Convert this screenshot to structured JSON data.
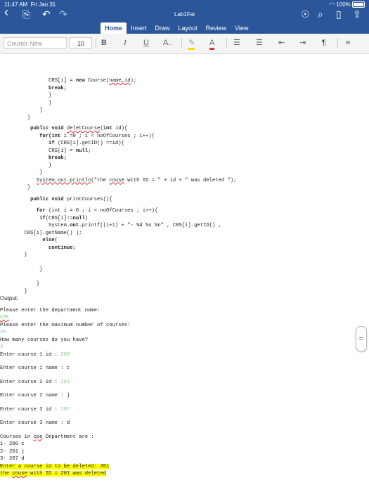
{
  "status": {
    "time": "11:47 AM",
    "date": "Fri Jan 31",
    "battery": "100%"
  },
  "title": "Lab1Fai",
  "tabs": [
    "Home",
    "Insert",
    "Draw",
    "Layout",
    "Review",
    "View"
  ],
  "ribbon": {
    "font_placeholder": "Courier New",
    "font_size": "10"
  },
  "icons": {
    "back": "chevron-left-icon",
    "file": "file-icon",
    "undo": "undo-icon",
    "redo": "redo-icon",
    "lightbulb": "lightbulb-icon",
    "search": "search-icon",
    "mobile": "mobile-view-icon",
    "share": "share-icon"
  },
  "colors": {
    "brand": "#2b579a",
    "highlight": "#ffff00",
    "input_value": "#8fc98f",
    "spell": "#d33333"
  },
  "code": {
    "l1_a": "CRS[i] = ",
    "l1_kw": "new",
    "l1_b": " Course(",
    "l1_sp": "name,id",
    "l1_c": ");",
    "l2": "break;",
    "l3": "}",
    "l4": "}",
    "l5": "}",
    "l6": "}",
    "l7_kw1": "public void",
    "l7_sp": "deletCourse",
    "l7_b": "(",
    "l7_kw2": "int",
    "l7_c": " id){",
    "l8_kw": "for(int",
    "l8_b": " i =0 ; i < noOfCourses ; i++){",
    "l9_kw": "if",
    "l9_b": " (CRS[i].getID() ==id){",
    "l10_a": "CRS[i] = ",
    "l10_kw": "null",
    "l10_b": ";",
    "l11": "break;",
    "l12": "}",
    "l13": "}",
    "l14_sp": "System.out.println",
    "l14_b": "(\"the ",
    "l14_sp2": "couse",
    "l14_c": " with ID = \" + id + \" was deleted \");",
    "l15": "}",
    "l16_kw": "public void",
    "l16_b": " printCourses(){",
    "l17_kw": "for",
    "l17_b": " (int i = 0 ; i < noOfCourses ; i++){",
    "l18_kw": "if",
    "l18_b": "(CRS[i]!=",
    "l18_kw2": "null",
    "l18_c": ")",
    "l19_a": "System.",
    "l19_kw": "out",
    "l19_b": ".printf((i+1) + \"- %d %s %n\" , CRS[i].getID() ,",
    "l20": "CRS[i].getName() );",
    "l21_kw": "else",
    "l21_b": "{",
    "l22_kw": "continue",
    "l22_b": ";",
    "l23": "}",
    "l24": "}",
    "l25": "}",
    "l26": "}"
  },
  "output": {
    "label": "Output:",
    "q1": "Please enter the department name:",
    "a1": "CPE",
    "q2": "Please enter the maximum number of courses:",
    "a2": "20",
    "q3": "How many courses do you have?",
    "a3": "3",
    "c1id": "Enter course 1 id :",
    "c1id_v": "200",
    "c1n": "Enter course 1 name : c",
    "c2id": "Enter course 2 id :",
    "c2id_v": "201",
    "c2n": "Enter course 2 name : j",
    "c3id": "Enter course 3 id :",
    "c3id_v": "207",
    "c3n": "Enter course 3 name : d",
    "list_a": "Courses in ",
    "list_sp": "cpe",
    "list_b": " Department are :",
    "r1": "1- 200 c",
    "r2": "2- 201 j",
    "r3": "3- 207 d",
    "del": "Enter a course id to be deleted: 201",
    "res_a": "the ",
    "res_sp": "couse",
    "res_b": " with ID = 201 was deleted"
  }
}
